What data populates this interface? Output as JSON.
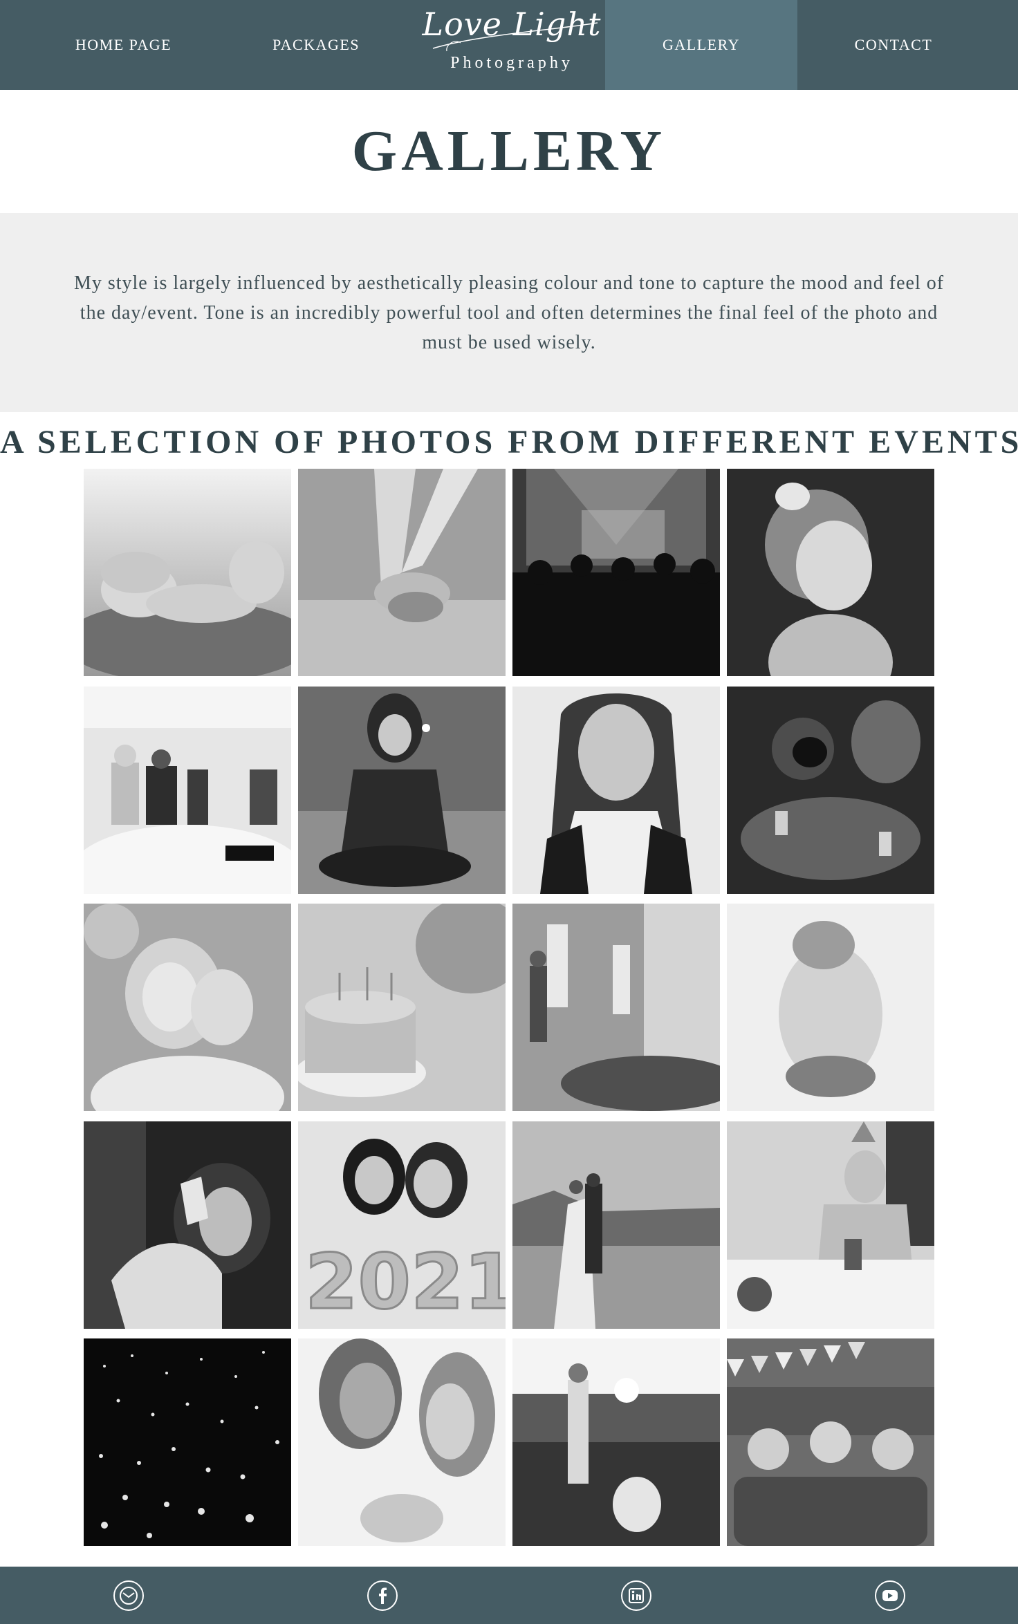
{
  "nav": {
    "items": [
      {
        "label": "HOME PAGE"
      },
      {
        "label": "PACKAGES"
      },
      {
        "label": "GALLERY",
        "active": true
      },
      {
        "label": "CONTACT"
      }
    ],
    "logo_script": "Love Light",
    "logo_sub": "Photography"
  },
  "page": {
    "title": "GALLERY",
    "intro": "My style is largely influenced by aesthetically pleasing colour and tone to capture the mood and feel of the day/event. Tone is an incredibly powerful tool and often determines the final feel of the photo and must be used wisely.",
    "section_heading": "A SELECTION OF PHOTOS FROM DIFFERENT EVENTS"
  },
  "gallery": {
    "photos": [
      {
        "subject": "sleeping-baby"
      },
      {
        "subject": "holding-hands"
      },
      {
        "subject": "concert-crowd"
      },
      {
        "subject": "smiling-girl"
      },
      {
        "subject": "conference"
      },
      {
        "subject": "woman-sparkler"
      },
      {
        "subject": "portrait-woman"
      },
      {
        "subject": "party-phones"
      },
      {
        "subject": "mother-daughter"
      },
      {
        "subject": "birthday-cake"
      },
      {
        "subject": "office-presentation"
      },
      {
        "subject": "baby-bow"
      },
      {
        "subject": "woman-portrait-window"
      },
      {
        "subject": "new-year-2021"
      },
      {
        "subject": "wedding-couple"
      },
      {
        "subject": "birthday-girl"
      },
      {
        "subject": "sky-lanterns"
      },
      {
        "subject": "couple-closeup"
      },
      {
        "subject": "family-field"
      },
      {
        "subject": "kids-party"
      }
    ]
  },
  "footer": {
    "icons": [
      "email-icon",
      "facebook-icon",
      "linkedin-icon",
      "youtube-icon"
    ]
  },
  "colors": {
    "nav_bg": "#455c64",
    "nav_active": "#577580",
    "intro_bg": "#efefef",
    "heading": "#2f4147"
  }
}
